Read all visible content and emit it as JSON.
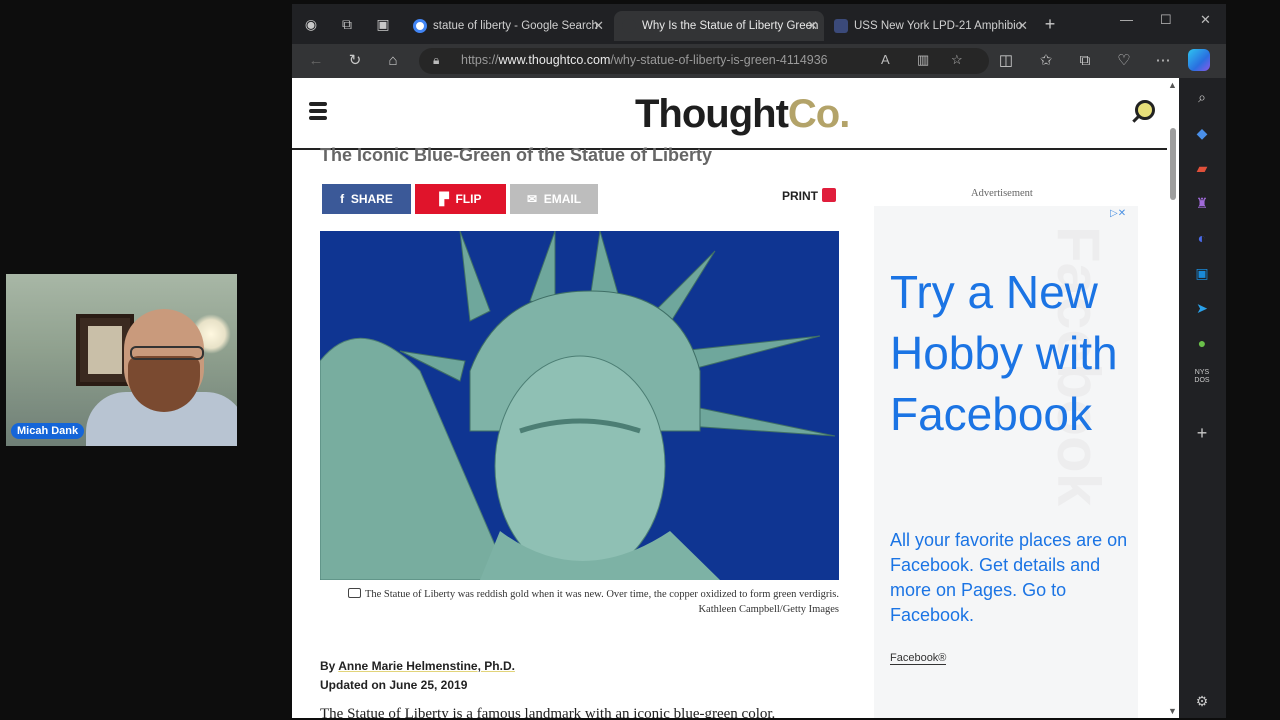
{
  "webcam": {
    "name": "Micah Dank"
  },
  "tabs": [
    {
      "title": "statue of liberty - Google Search",
      "active": false,
      "favicon_color": "#ffffff"
    },
    {
      "title": "Why Is the Statue of Liberty Green",
      "active": true,
      "favicon_color": "#333436"
    },
    {
      "title": "USS New York LPD-21 Amphibio",
      "active": false,
      "favicon_color": "#3b4a7a"
    }
  ],
  "new_tab": "+",
  "address": {
    "prefix": "https://",
    "domain": "www.thoughtco.com",
    "path": "/why-statue-of-liberty-is-green-4114936"
  },
  "site": {
    "logo_main": "Thought",
    "logo_accent": "Co."
  },
  "article": {
    "heading": "The Iconic Blue-Green of the Statue of Liberty",
    "share": [
      "SHARE",
      "FLIP",
      "EMAIL"
    ],
    "print": "PRINT",
    "caption": "The Statue of Liberty was reddish gold when it was new. Over time, the copper oxidized to form green verdigris.",
    "credit": "Kathleen Campbell/Getty Images",
    "by_prefix": "By ",
    "author": "Anne Marie Helmenstine, Ph.D.",
    "updated": "Updated on June 25, 2019",
    "para_a": "The ",
    "para_link": "Statue of Liberty",
    "para_b": " is a famous landmark with an iconic blue-green color."
  },
  "ad": {
    "label": "Advertisement",
    "headline": "Try a New Hobby with Facebook",
    "body": "All your favorite places are on Facebook. Get details and more on Pages. Go to Facebook.",
    "brand": "Facebook®",
    "watermark": "Facebook"
  },
  "colors": {
    "share": "#3b5998",
    "flip": "#e0142b",
    "email": "#bdbdbd",
    "accent": "#b3a369",
    "fb_blue": "#1b74e4"
  }
}
